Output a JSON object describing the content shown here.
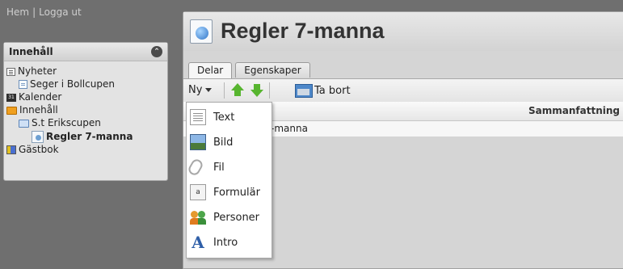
{
  "top_links": {
    "home": "Hem",
    "separator": "|",
    "logout": "Logga ut"
  },
  "nav": {
    "header": "Innehåll",
    "items": [
      {
        "label": "Nyheter",
        "icon": "news-icon"
      },
      {
        "label": "Seger i Bollcupen",
        "icon": "document-icon"
      },
      {
        "label": "Kalender",
        "icon": "calendar-icon"
      },
      {
        "label": "Innehåll",
        "icon": "folder-icon"
      },
      {
        "label": "S.t Erikscupen",
        "icon": "folder-icon"
      },
      {
        "label": "Regler 7-manna",
        "icon": "page-icon",
        "selected": true
      },
      {
        "label": "Gästbok",
        "icon": "guestbook-icon"
      }
    ]
  },
  "page": {
    "title": "Regler 7-manna"
  },
  "tabs": [
    {
      "label": "Delar",
      "active": true
    },
    {
      "label": "Egenskaper",
      "active": false
    }
  ],
  "toolbar": {
    "new_label": "Ny",
    "delete_label": "Ta bort"
  },
  "grid": {
    "columns": [
      "Sammanfattning"
    ],
    "rows": [
      {
        "name": "Regler 7-manna"
      }
    ],
    "visible_row_text": "-manna"
  },
  "new_menu": {
    "items": [
      {
        "label": "Text",
        "icon": "text-icon"
      },
      {
        "label": "Bild",
        "icon": "image-icon"
      },
      {
        "label": "Fil",
        "icon": "paperclip-icon"
      },
      {
        "label": "Formulär",
        "icon": "form-icon"
      },
      {
        "label": "Personer",
        "icon": "people-icon"
      },
      {
        "label": "Intro",
        "icon": "intro-icon"
      }
    ]
  },
  "colors": {
    "background": "#6f6f6f",
    "panel": "#e3e3e3",
    "accent_green": "#57b52f"
  }
}
